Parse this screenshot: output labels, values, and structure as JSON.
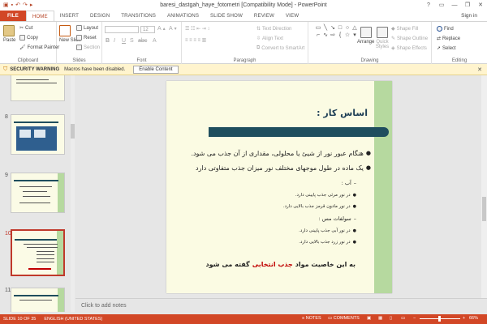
{
  "titlebar": {
    "title": "baresi_dastgah_haye_fotometri [Compatibility Mode] - PowerPoint",
    "window_buttons": [
      "?",
      "▭",
      "—",
      "❐",
      "✕"
    ]
  },
  "tabs": [
    "FILE",
    "HOME",
    "INSERT",
    "DESIGN",
    "TRANSITIONS",
    "ANIMATIONS",
    "SLIDE SHOW",
    "REVIEW",
    "VIEW"
  ],
  "active_tab": "HOME",
  "sign_in": "Sign in",
  "ribbon": {
    "clipboard": {
      "paste": "Paste",
      "cut": "Cut",
      "copy": "Copy",
      "format_painter": "Format Painter",
      "label": "Clipboard"
    },
    "slides": {
      "new_slide": "New Slide",
      "layout": "Layout",
      "reset": "Reset",
      "section": "Section",
      "label": "Slides"
    },
    "font": {
      "size": "12",
      "label": "Font"
    },
    "paragraph": {
      "text_direction": "Text Direction",
      "align_text": "Align Text",
      "convert_smartart": "Convert to SmartArt",
      "label": "Paragraph"
    },
    "drawing": {
      "arrange": "Arrange",
      "quick_styles": "Quick Styles",
      "shape_fill": "Shape Fill",
      "shape_outline": "Shape Outline",
      "shape_effects": "Shape Effects",
      "label": "Drawing"
    },
    "editing": {
      "find": "Find",
      "replace": "Replace",
      "select": "Select",
      "label": "Editing"
    }
  },
  "security": {
    "title": "SECURITY WARNING",
    "message": "Macros have been disabled.",
    "button": "Enable Content"
  },
  "thumbnails": [
    {
      "number": "8"
    },
    {
      "number": "9"
    },
    {
      "number": "10"
    },
    {
      "number": "11"
    }
  ],
  "slide": {
    "title": "اساس کار :",
    "lines": [
      {
        "level": 1,
        "text": "هنگام عبور نور از شیئ یا محلولی، مقداری از آن جذب می شود."
      },
      {
        "level": 1,
        "text": "یک ماده در طول موجهای مختلف نور میزان جذب متفاوتی دارد"
      },
      {
        "level": 2,
        "text": "آب :"
      },
      {
        "level": 3,
        "text": "در نور مرئی جذب پایینی دارد."
      },
      {
        "level": 3,
        "text": "در نور مادون قرمز جذب بالایی دارد."
      },
      {
        "level": 2,
        "text": "سولفات مس :"
      },
      {
        "level": 3,
        "text": "در نور آبی جذب پایینی دارد."
      },
      {
        "level": 3,
        "text": "در نور زرد جذب بالایی دارد."
      }
    ],
    "footer_pre": "به این خاصیت مواد",
    "footer_highlight": "جذب انتخابی",
    "footer_post": "گفته می شود"
  },
  "notes_placeholder": "Click to add notes",
  "status": {
    "slide": "SLIDE 10 OF 35",
    "language": "ENGLISH (UNITED STATES)",
    "notes": "NOTES",
    "comments": "COMMENTS",
    "zoom": "66%"
  },
  "colors": {
    "accent": "#d24726",
    "slide_background": "#fbfbe3",
    "slide_sidebar": "#b6d99f",
    "title_bar_rule": "#1f4e5e",
    "highlight_text": "#c00000"
  }
}
